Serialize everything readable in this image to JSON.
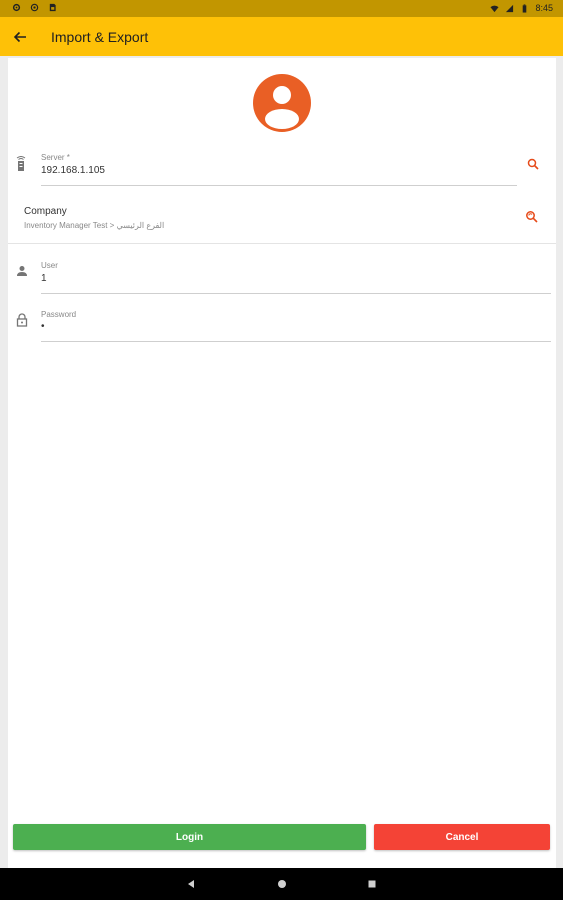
{
  "status_bar": {
    "time": "8:45",
    "icons": [
      "settings-icon",
      "sync-icon",
      "sim-icon",
      "wifi-icon",
      "signal-icon",
      "battery-icon"
    ]
  },
  "app_bar": {
    "title": "Import & Export",
    "back_icon": "arrow-back-icon",
    "color": "#fec107"
  },
  "profile": {
    "avatar_icon": "account-circle-icon",
    "avatar_color": "#e95f25"
  },
  "form": {
    "server": {
      "label": "Server *",
      "value": "192.168.1.105",
      "icon": "router-icon",
      "action_icon": "search-icon"
    },
    "company": {
      "title": "Company",
      "subtitle": "Inventory Manager Test > الفرع الرئيسي",
      "action_icon": "search-refresh-icon"
    },
    "user": {
      "label": "User",
      "value": "1",
      "icon": "person-icon"
    },
    "password": {
      "label": "Password",
      "value": "•",
      "icon": "lock-icon"
    }
  },
  "actions": {
    "login_label": "Login",
    "login_color": "#4caf50",
    "cancel_label": "Cancel",
    "cancel_color": "#f44336"
  },
  "nav_bar": {
    "icons": [
      "back-triangle-icon",
      "home-circle-icon",
      "recents-square-icon"
    ]
  }
}
